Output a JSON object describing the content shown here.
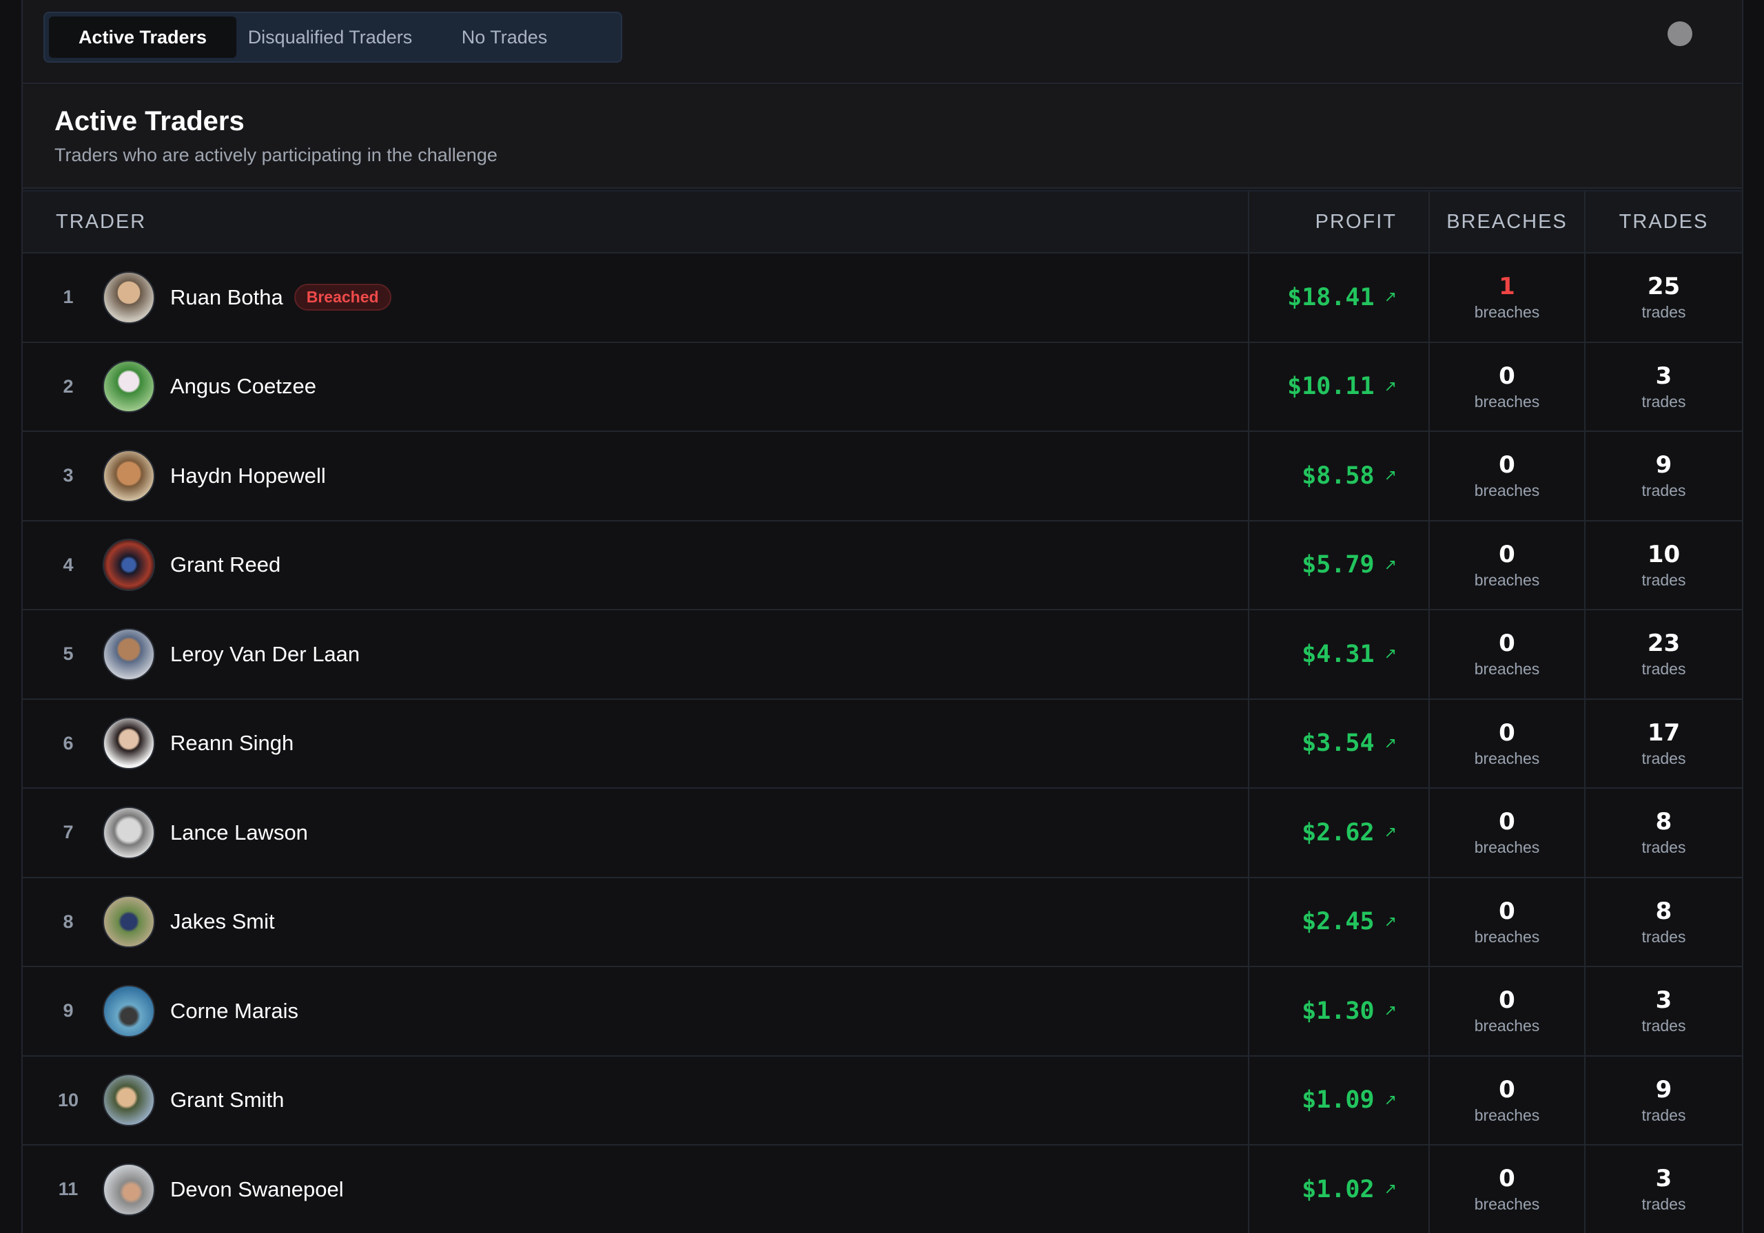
{
  "tabs": [
    {
      "label": "Active Traders",
      "active": true
    },
    {
      "label": "Disqualified Traders",
      "active": false
    },
    {
      "label": "No Trades",
      "active": false
    }
  ],
  "section": {
    "title": "Active Traders",
    "subtitle": "Traders who are actively participating in the challenge"
  },
  "table": {
    "headers": {
      "trader": "TRADER",
      "profit": "PROFIT",
      "breaches": "BREACHES",
      "trades": "TRADES"
    },
    "rows": [
      {
        "rank": "1",
        "name": "Ruan Botha",
        "badge": "Breached",
        "profit": "$18.41",
        "breaches": "1",
        "breaches_label": "breaches",
        "trades": "25",
        "trades_label": "trades"
      },
      {
        "rank": "2",
        "name": "Angus Coetzee",
        "badge": "",
        "profit": "$10.11",
        "breaches": "0",
        "breaches_label": "breaches",
        "trades": "3",
        "trades_label": "trades"
      },
      {
        "rank": "3",
        "name": "Haydn Hopewell",
        "badge": "",
        "profit": "$8.58",
        "breaches": "0",
        "breaches_label": "breaches",
        "trades": "9",
        "trades_label": "trades"
      },
      {
        "rank": "4",
        "name": "Grant Reed",
        "badge": "",
        "profit": "$5.79",
        "breaches": "0",
        "breaches_label": "breaches",
        "trades": "10",
        "trades_label": "trades"
      },
      {
        "rank": "5",
        "name": "Leroy Van Der Laan",
        "badge": "",
        "profit": "$4.31",
        "breaches": "0",
        "breaches_label": "breaches",
        "trades": "23",
        "trades_label": "trades"
      },
      {
        "rank": "6",
        "name": "Reann Singh",
        "badge": "",
        "profit": "$3.54",
        "breaches": "0",
        "breaches_label": "breaches",
        "trades": "17",
        "trades_label": "trades"
      },
      {
        "rank": "7",
        "name": "Lance Lawson",
        "badge": "",
        "profit": "$2.62",
        "breaches": "0",
        "breaches_label": "breaches",
        "trades": "8",
        "trades_label": "trades"
      },
      {
        "rank": "8",
        "name": "Jakes Smit",
        "badge": "",
        "profit": "$2.45",
        "breaches": "0",
        "breaches_label": "breaches",
        "trades": "8",
        "trades_label": "trades"
      },
      {
        "rank": "9",
        "name": "Corne Marais",
        "badge": "",
        "profit": "$1.30",
        "breaches": "0",
        "breaches_label": "breaches",
        "trades": "3",
        "trades_label": "trades"
      },
      {
        "rank": "10",
        "name": "Grant Smith",
        "badge": "",
        "profit": "$1.09",
        "breaches": "0",
        "breaches_label": "breaches",
        "trades": "9",
        "trades_label": "trades"
      },
      {
        "rank": "11",
        "name": "Devon Swanepoel",
        "badge": "",
        "profit": "$1.02",
        "breaches": "0",
        "breaches_label": "breaches",
        "trades": "3",
        "trades_label": "trades"
      }
    ]
  },
  "icons": {
    "trend": "arrow-up-right-icon",
    "user_menu": "user-menu-icon"
  },
  "colors": {
    "profit": "#22c55e",
    "breach": "#ef4444",
    "tab_bg": "#1c2738"
  }
}
